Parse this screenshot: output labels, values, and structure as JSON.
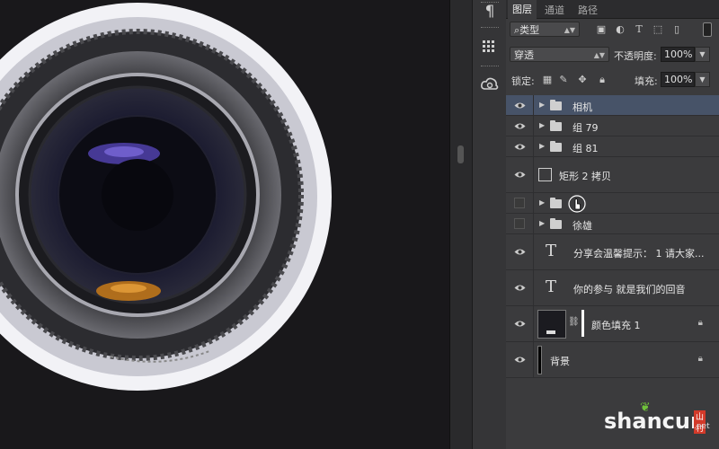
{
  "panel": {
    "tabs": [
      "图层",
      "通道",
      "路径"
    ],
    "filter_type": "类型",
    "blend_mode": "穿透",
    "opacity_label": "不透明度:",
    "opacity_value": "100%",
    "lock_label": "锁定:",
    "fill_label": "填充:",
    "fill_value": "100%"
  },
  "layers": [
    {
      "name": "相机",
      "kind": "group",
      "visible": true,
      "selected": true
    },
    {
      "name": "组 79",
      "kind": "group",
      "visible": true
    },
    {
      "name": "组 81",
      "kind": "group",
      "visible": true
    },
    {
      "name": "矩形 2 拷贝",
      "kind": "shape",
      "visible": true
    },
    {
      "name": "",
      "kind": "group",
      "visible": false
    },
    {
      "name": "徐雄",
      "kind": "group",
      "visible": false
    },
    {
      "name": "分享会温馨提示：  1 请大家...",
      "kind": "text",
      "visible": true
    },
    {
      "name": "你的参与 就是我们的回音",
      "kind": "text",
      "visible": true
    },
    {
      "name": "颜色填充 1",
      "kind": "fill",
      "visible": true,
      "locked": true
    },
    {
      "name": "背景",
      "kind": "background",
      "visible": true,
      "locked": true
    }
  ],
  "watermark": {
    "brand": "shancun",
    "suffix": ".net",
    "cn": "山村"
  },
  "colors": {
    "selected_row": "#475368",
    "panel_bg": "#3b3b3d",
    "canvas_bg": "#19181b"
  },
  "icons": [
    "paragraph-icon",
    "glyph-grid-icon",
    "creative-cloud-icon",
    "eye-icon",
    "folder-icon",
    "lock-icon",
    "hand-cursor-icon"
  ]
}
